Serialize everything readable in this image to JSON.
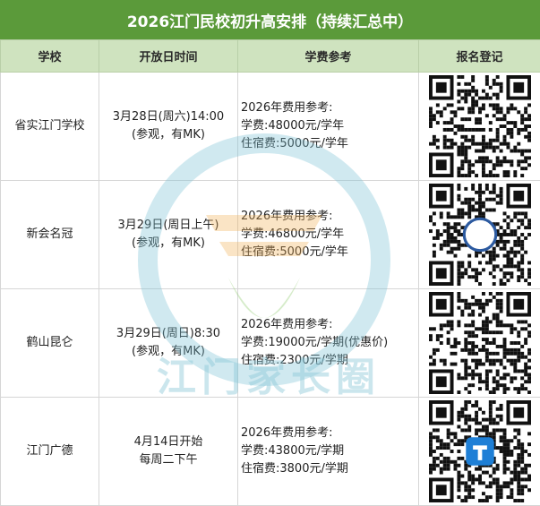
{
  "title": "2026江门民校初升高安排（持续汇总中）",
  "headers": [
    "学校",
    "开放日时间",
    "学费参考",
    "报名登记"
  ],
  "rows": [
    {
      "school": "省实江门学校",
      "time": [
        "3月28日(周六)14:00",
        "(参观，有MK)"
      ],
      "fee": [
        "2026年费用参考:",
        "学费:48000元/学年",
        "住宿费:5000元/学年"
      ]
    },
    {
      "school": "新会名冠",
      "time": [
        "3月29日(周日上午)",
        "(参观，有MK)"
      ],
      "fee": [
        "2026年费用参考:",
        "学费:46800元/学年",
        "住宿费:5000元/学年"
      ]
    },
    {
      "school": "鹤山昆仑",
      "time": [
        "3月29日(周日)8:30",
        "(参观，有MK)"
      ],
      "fee": [
        "2026年费用参考:",
        "学费:19000元/学期(优惠价)",
        "住宿费:2300元/学期"
      ]
    },
    {
      "school": "江门广德",
      "time": [
        "4月14日开始",
        "每周二下午"
      ],
      "fee": [
        "2026年费用参考:",
        "学费:43800元/学期",
        "住宿费:3800元/学期"
      ]
    }
  ],
  "watermark_text": "江门家长圈",
  "colors": {
    "title_bg": "#5b9a3a",
    "header_bg": "#cfe3bf"
  }
}
